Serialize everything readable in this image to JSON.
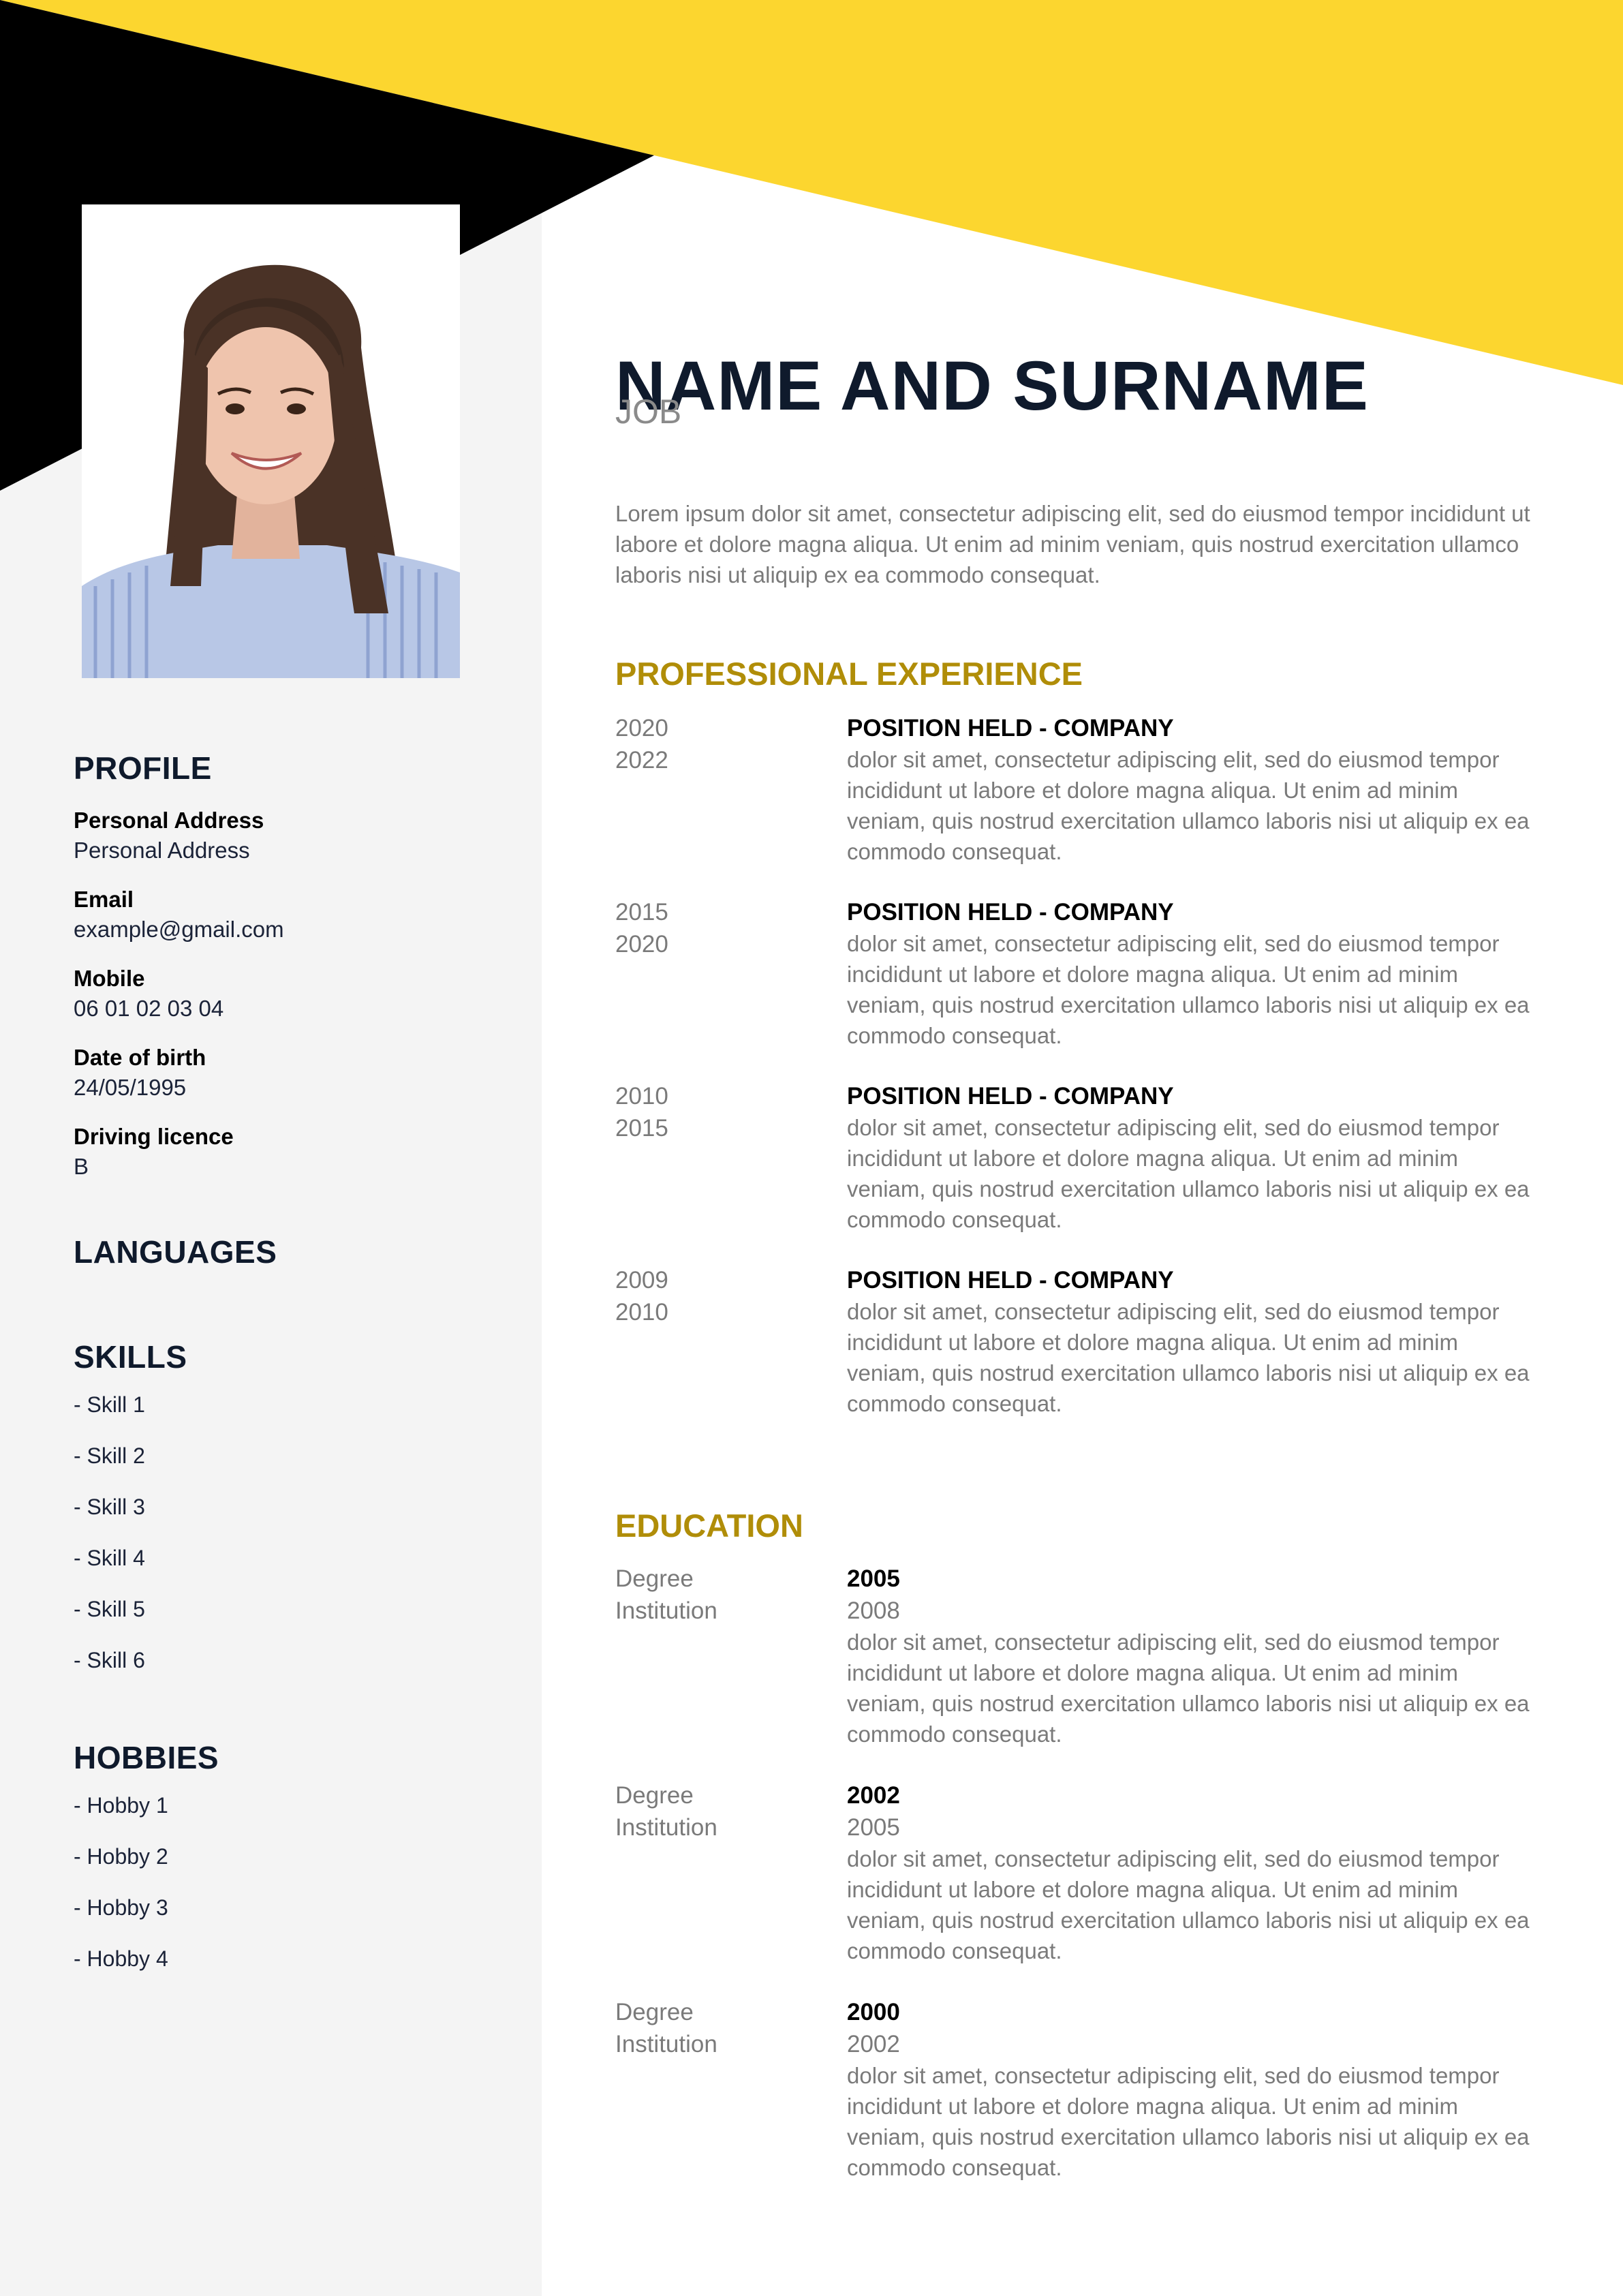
{
  "colors": {
    "accent_yellow": "#fcd62f",
    "black": "#000000",
    "sidebar_bg": "#f4f4f4",
    "heading_navy": "#0f1a2c",
    "section_gold": "#b08d08",
    "muted_gray": "#7a7a7a"
  },
  "photo": {
    "icon": "portrait-photo",
    "alt": "Profile photo of smiling woman with long brown hair in striped blue shirt"
  },
  "header": {
    "name": "NAME AND SURNAME",
    "job": "JOB",
    "intro": "Lorem ipsum dolor sit amet, consectetur adipiscing elit, sed do eiusmod tempor incididunt ut labore et dolore magna aliqua. Ut enim ad minim veniam, quis nostrud exercitation ullamco laboris nisi ut aliquip ex ea commodo consequat."
  },
  "sidebar": {
    "profile": {
      "heading": "PROFILE",
      "fields": [
        {
          "label": "Personal Address",
          "value": "Personal Address"
        },
        {
          "label": "Email",
          "value": "example@gmail.com"
        },
        {
          "label": "Mobile",
          "value": "06 01 02 03 04"
        },
        {
          "label": "Date of birth",
          "value": "24/05/1995"
        },
        {
          "label": "Driving licence",
          "value": "B"
        }
      ]
    },
    "languages": {
      "heading": "LANGUAGES"
    },
    "skills": {
      "heading": "SKILLS",
      "items": [
        "- Skill 1",
        "- Skill 2",
        "- Skill 3",
        "- Skill 4",
        "- Skill 5",
        "- Skill 6"
      ]
    },
    "hobbies": {
      "heading": "HOBBIES",
      "items": [
        "- Hobby 1",
        "- Hobby 2",
        "- Hobby 3",
        "- Hobby 4"
      ]
    }
  },
  "experience": {
    "heading": "PROFESSIONAL EXPERIENCE",
    "entries": [
      {
        "start": "2020",
        "end": "2022",
        "title": "POSITION HELD - COMPANY",
        "desc": "dolor sit amet, consectetur adipiscing elit, sed do eiusmod tempor incididunt ut labore et dolore magna aliqua. Ut enim ad minim veniam, quis nostrud exercitation ullamco laboris nisi ut aliquip ex ea commodo consequat."
      },
      {
        "start": "2015",
        "end": "2020",
        "title": "POSITION HELD - COMPANY",
        "desc": "dolor sit amet, consectetur adipiscing elit, sed do eiusmod tempor incididunt ut labore et dolore magna aliqua. Ut enim ad minim veniam, quis nostrud exercitation ullamco laboris nisi ut aliquip ex ea commodo consequat."
      },
      {
        "start": "2010",
        "end": "2015",
        "title": "POSITION HELD - COMPANY",
        "desc": "dolor sit amet, consectetur adipiscing elit, sed do eiusmod tempor incididunt ut labore et dolore magna aliqua. Ut enim ad minim veniam, quis nostrud exercitation ullamco laboris nisi ut aliquip ex ea commodo consequat."
      },
      {
        "start": "2009",
        "end": "2010",
        "title": "POSITION HELD - COMPANY",
        "desc": "dolor sit amet, consectetur adipiscing elit, sed do eiusmod tempor incididunt ut labore et dolore magna aliqua. Ut enim ad minim veniam, quis nostrud exercitation ullamco laboris nisi ut aliquip ex ea commodo consequat."
      }
    ]
  },
  "education": {
    "heading": "EDUCATION",
    "entries": [
      {
        "degree": "Degree",
        "institution": "Institution",
        "start": "2005",
        "end": "2008",
        "desc": "dolor sit amet, consectetur adipiscing elit, sed do eiusmod tempor incididunt ut labore et dolore magna aliqua. Ut enim ad minim veniam, quis nostrud exercitation ullamco laboris nisi ut aliquip ex ea commodo consequat."
      },
      {
        "degree": "Degree",
        "institution": "Institution",
        "start": "2002",
        "end": "2005",
        "desc": "dolor sit amet, consectetur adipiscing elit, sed do eiusmod tempor incididunt ut labore et dolore magna aliqua. Ut enim ad minim veniam, quis nostrud exercitation ullamco laboris nisi ut aliquip ex ea commodo consequat."
      },
      {
        "degree": "Degree",
        "institution": "Institution",
        "start": "2000",
        "end": "2002",
        "desc": "dolor sit amet, consectetur adipiscing elit, sed do eiusmod tempor incididunt ut labore et dolore magna aliqua. Ut enim ad minim veniam, quis nostrud exercitation ullamco laboris nisi ut aliquip ex ea commodo consequat."
      }
    ]
  }
}
